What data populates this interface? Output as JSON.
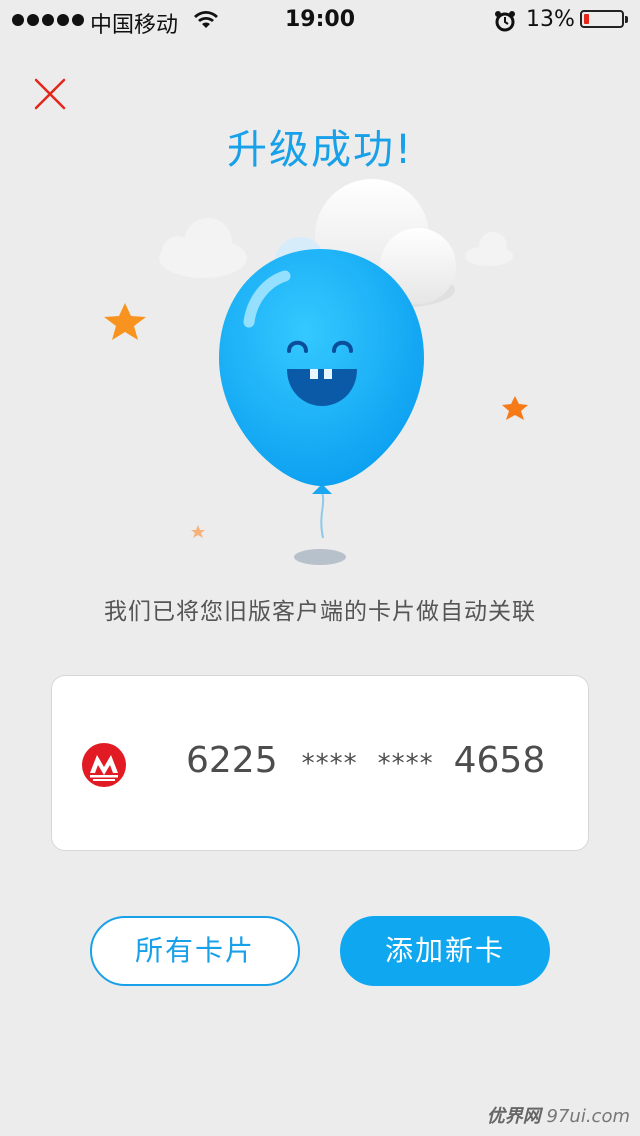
{
  "status_bar": {
    "carrier": "中国移动",
    "time": "19:00",
    "battery_percent": "13%",
    "battery_level": 0.13,
    "icons": [
      "signal-dots-icon",
      "wifi-icon",
      "alarm-icon",
      "battery-icon"
    ]
  },
  "header": {
    "close_icon": "close-icon",
    "title": "升级成功!"
  },
  "message": "我们已将您旧版客户端的卡片做自动关联",
  "card": {
    "bank_icon": "cmb-bank-logo-icon",
    "number_groups": [
      "6225",
      "****",
      "****",
      "4658"
    ]
  },
  "buttons": {
    "all_cards": "所有卡片",
    "add_card": "添加新卡"
  },
  "watermark": {
    "cn": "优界网",
    "domain": "97ui.com"
  },
  "colors": {
    "accent": "#18a0e9",
    "close_red": "#e4261b",
    "star_orange": "#f7931e",
    "balloon_blue": "#16b4f5"
  }
}
